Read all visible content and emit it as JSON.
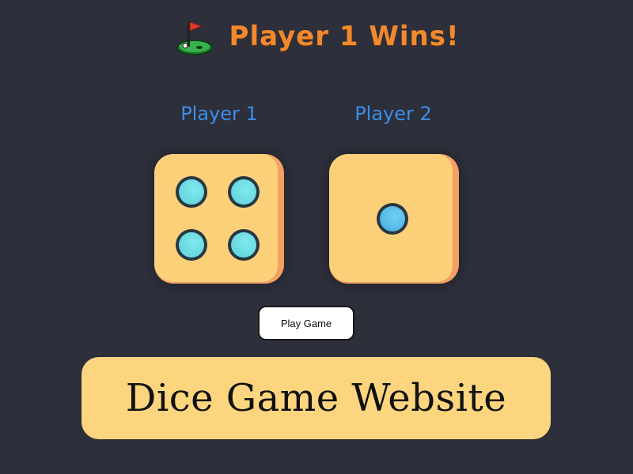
{
  "headline": {
    "icon": "golf-flag-icon",
    "text": "Player 1 Wins!"
  },
  "players": [
    {
      "label": "Player 1",
      "die_value": 4
    },
    {
      "label": "Player 2",
      "die_value": 1
    }
  ],
  "play_button": {
    "label": "Play Game"
  },
  "banner": {
    "text": "Dice Game Website"
  },
  "colors": {
    "background": "#2d2f3b",
    "headline": "#f1892d",
    "player_label": "#3b8ee6",
    "die_face": "#fbd079",
    "die_side": "#f4a063",
    "pip": "#67d7de",
    "banner": "#fcd57e"
  }
}
